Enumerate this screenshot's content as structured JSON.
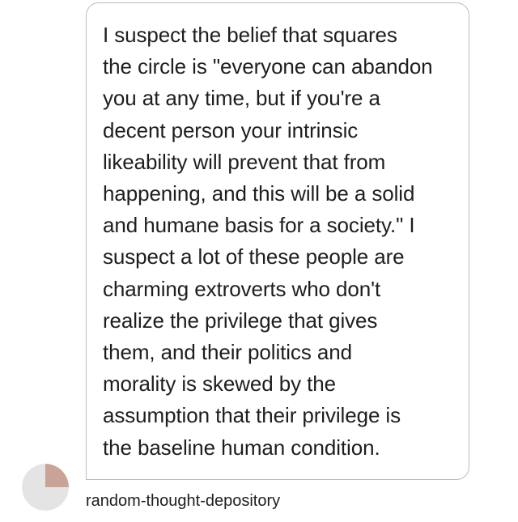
{
  "message": {
    "lines": [
      "I suspect the belief that squares",
      "the circle is \"everyone can abandon",
      "you at any time, but if you're a",
      "decent person your intrinsic",
      "likeability will prevent that from",
      "happening, and this will be a solid",
      "and humane basis for a society.\" I",
      "suspect a lot of these people are",
      "charming extroverts who don't",
      "realize the privilege that gives",
      "them, and their politics and",
      "morality is skewed by the",
      "assumption that their privilege is",
      "the baseline human condition."
    ]
  },
  "sender": {
    "username": "random-thought-depository",
    "avatar_colors": {
      "base": "#e4e4e4",
      "accent": "#c9a397"
    }
  }
}
